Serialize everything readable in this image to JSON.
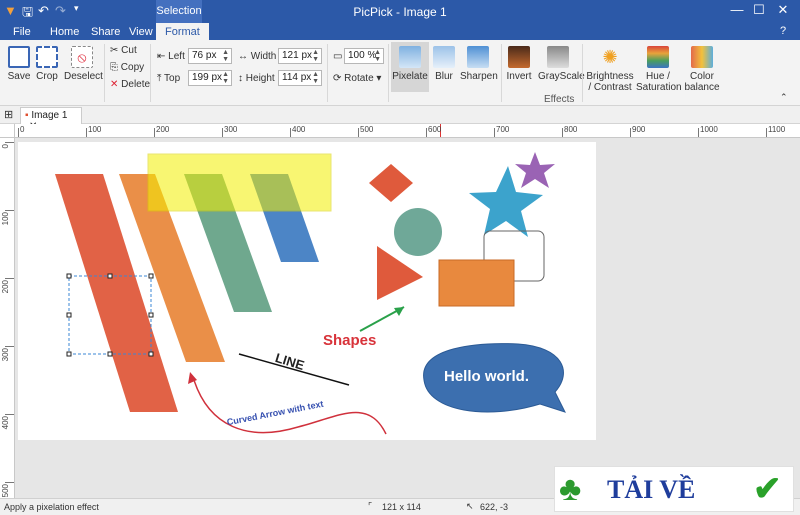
{
  "window": {
    "title": "PicPick - Image 1",
    "context_tab": "Selection"
  },
  "menu": [
    "File",
    "Home",
    "Share",
    "View",
    "Format"
  ],
  "ribbon": {
    "save": "Save",
    "crop": "Crop",
    "deselect": "Deselect",
    "cut": "Cut",
    "copy": "Copy",
    "delete": "Delete",
    "left_label": "Left",
    "left_value": "76 px",
    "top_label": "Top",
    "top_value": "199 px",
    "width_label": "Width",
    "width_value": "121 px",
    "height_label": "Height",
    "height_value": "114 px",
    "zoom_value": "100 %",
    "rotate": "Rotate",
    "effects": [
      "Pixelate",
      "Blur",
      "Sharpen",
      "Invert",
      "GrayScale",
      "Brightness / Contrast",
      "Hue / Saturation",
      "Color balance"
    ],
    "effects_group": "Effects"
  },
  "doc_tab": "Image 1",
  "ruler_h": [
    "0",
    "100",
    "200",
    "300",
    "400",
    "500",
    "600",
    "700",
    "800",
    "900",
    "1000",
    "1100"
  ],
  "ruler_v": [
    "0",
    "100",
    "200",
    "300",
    "400",
    "500"
  ],
  "canvas": {
    "shapes_label": "Shapes",
    "line_label": "LINE",
    "curved_text": "Curved Arrow with text",
    "bubble_text": "Hello world."
  },
  "status": {
    "hint": "Apply a pixelation effect",
    "size": "121 x 114",
    "cursor": "622, -3"
  },
  "watermark": "TẢI VỀ"
}
